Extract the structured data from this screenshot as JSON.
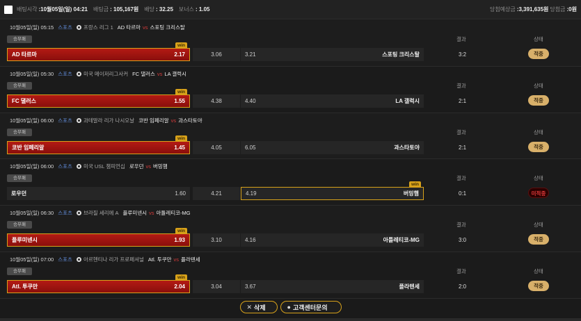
{
  "header": {
    "bet_time_label": "배팅시각",
    "bet_time_value": ":10월05일(일) 04:21",
    "bet_amount_label": "배팅금",
    "bet_amount_value": ": 105,167원",
    "odds_label": "배당",
    "odds_value": ": 32.25",
    "bonus_label": "보너스",
    "bonus_value": ": 1.05",
    "expected_win_label": "당첨예상금",
    "expected_win_value": ":3,391,635원",
    "won_label": "당첨금",
    "won_value": ":0원"
  },
  "columns": {
    "result": "결과",
    "status": "상태"
  },
  "market_label": "승무패",
  "sport_label": "스포츠",
  "vs": "vs",
  "win_tag": "win",
  "games": [
    {
      "date": "10월05일(일) 05:15",
      "league": "프랑스 리그 1",
      "home": "AD 타르마",
      "away": "스포팅 크리스탈",
      "home_odds": "2.17",
      "draw_odds": "3.06",
      "away_odds": "3.21",
      "selected": "home",
      "result": "3:2",
      "status": "적중",
      "status_type": "hit"
    },
    {
      "date": "10월05일(일) 05:30",
      "league": "미국 메이저리그사커",
      "home": "FC 댈러스",
      "away": "LA 갤럭시",
      "home_odds": "1.55",
      "draw_odds": "4.38",
      "away_odds": "4.40",
      "selected": "home",
      "result": "2:1",
      "status": "적중",
      "status_type": "hit"
    },
    {
      "date": "10월05일(일) 06:00",
      "league": "과테말라 리가 나시오날",
      "home": "코반 임페리알",
      "away": "과스타토야",
      "home_odds": "1.45",
      "draw_odds": "4.05",
      "away_odds": "6.05",
      "selected": "home",
      "result": "2:1",
      "status": "적중",
      "status_type": "hit"
    },
    {
      "date": "10월05일(일) 06:00",
      "league": "미국 USL 챔피언십",
      "home": "로우던",
      "away": "버밍햄",
      "home_odds": "1.60",
      "draw_odds": "4.21",
      "away_odds": "4.19",
      "selected": "away",
      "result": "0:1",
      "status": "미적중",
      "status_type": "miss"
    },
    {
      "date": "10월05일(일) 06:30",
      "league": "브라질 세리에 A",
      "home": "플루미넨시",
      "away": "아틀레티코-MG",
      "home_odds": "1.93",
      "draw_odds": "3.10",
      "away_odds": "4.16",
      "selected": "home",
      "result": "3:0",
      "status": "적중",
      "status_type": "hit"
    },
    {
      "date": "10월05일(일) 07:00",
      "league": "아르헨티나 리가 프로페셔널",
      "home": "Atl. 투쿠만",
      "away": "플라텐세",
      "home_odds": "2.04",
      "draw_odds": "3.04",
      "away_odds": "3.67",
      "selected": "home",
      "result": "2:0",
      "status": "적중",
      "status_type": "hit"
    }
  ],
  "footer": {
    "delete_label": "삭제",
    "delete_icon": "close-x-icon",
    "customer_center_label": "고객센터문의",
    "customer_center_icon": "user-icon"
  },
  "colors": {
    "selected_bg": "#b31a14",
    "selected_border": "#d8a21a",
    "hit_badge": "#d8b06a",
    "miss_text": "#e23a3a",
    "vs": "#d23a3a",
    "sport_link": "#5d86d0"
  }
}
